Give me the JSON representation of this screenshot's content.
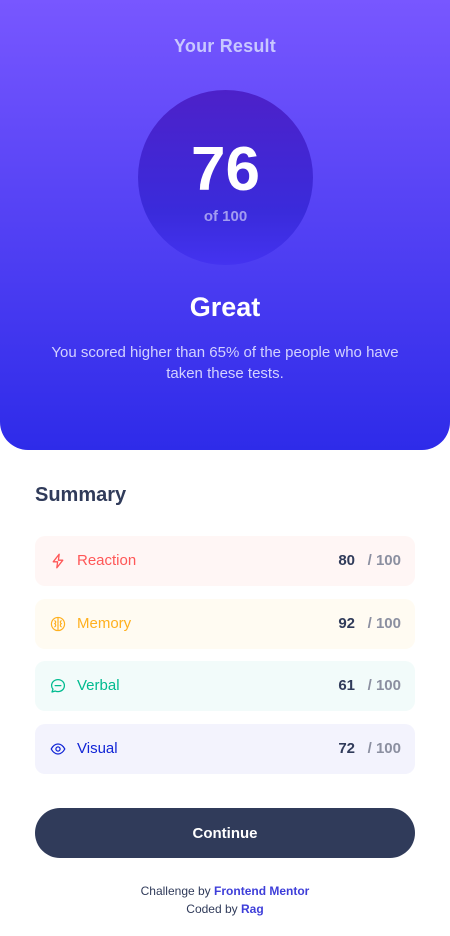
{
  "result": {
    "title": "Your Result",
    "score": "76",
    "max": "of 100",
    "rating": "Great",
    "description": "You scored higher than 65% of the people who have taken these tests."
  },
  "summary": {
    "title": "Summary",
    "items": [
      {
        "label": "Reaction",
        "score": "80",
        "max": "/ 100",
        "icon": "lightning-icon",
        "color": "#ff5757"
      },
      {
        "label": "Memory",
        "score": "92",
        "max": "/ 100",
        "icon": "brain-icon",
        "color": "#ffb01f"
      },
      {
        "label": "Verbal",
        "score": "61",
        "max": "/ 100",
        "icon": "chat-bubble-icon",
        "color": "#00bb8f"
      },
      {
        "label": "Visual",
        "score": "72",
        "max": "/ 100",
        "icon": "eye-icon",
        "color": "#1125d6"
      }
    ]
  },
  "continue_label": "Continue",
  "attribution": {
    "challenge_prefix": "Challenge by",
    "challenge_link": "Frontend Mentor",
    "coded_prefix": "Coded by",
    "coded_link": "Rag"
  },
  "colors": {
    "gradient_top": "#7857ff",
    "gradient_bottom": "#2e2be9",
    "button": "#303b5a"
  }
}
